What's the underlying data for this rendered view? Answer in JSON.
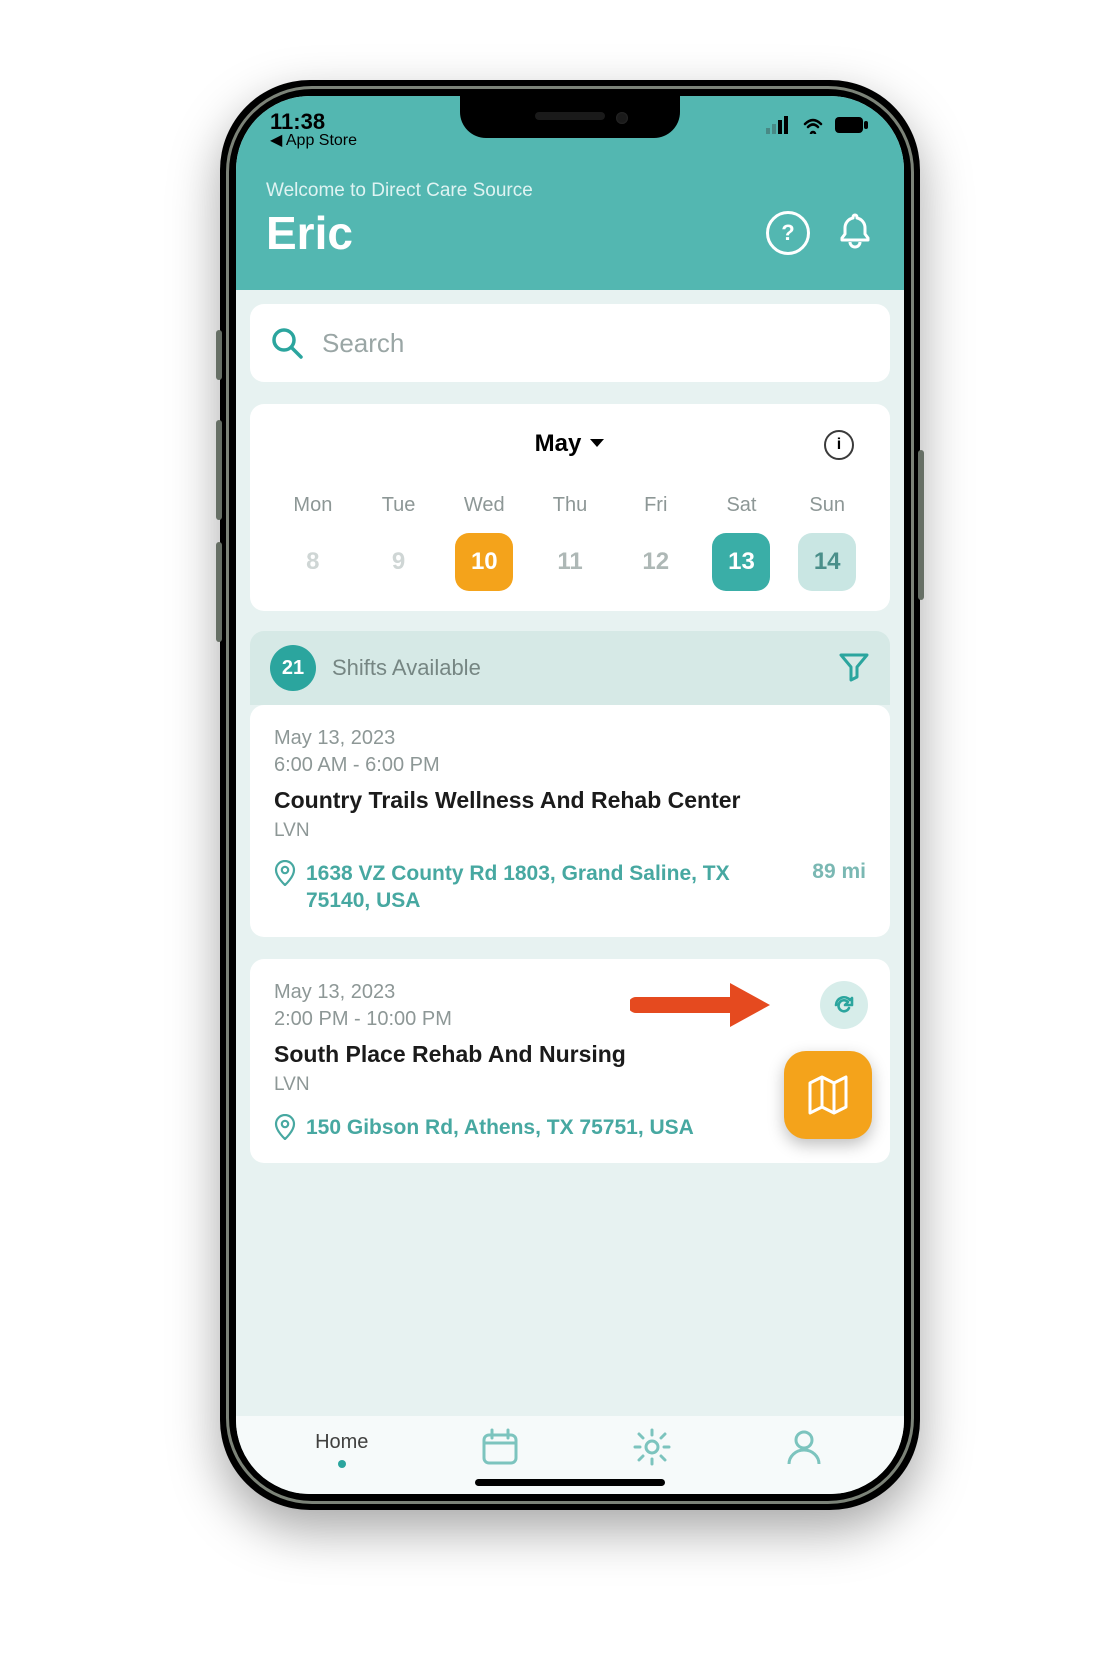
{
  "status": {
    "time": "11:38",
    "back": "◀ App Store"
  },
  "header": {
    "welcome": "Welcome to Direct Care Source",
    "name": "Eric"
  },
  "search": {
    "placeholder": "Search"
  },
  "calendar": {
    "month": "May",
    "days": [
      {
        "label": "Mon",
        "num": "8",
        "style": "dim"
      },
      {
        "label": "Tue",
        "num": "9",
        "style": "dim"
      },
      {
        "label": "Wed",
        "num": "10",
        "style": "orange"
      },
      {
        "label": "Thu",
        "num": "11",
        "style": "plain"
      },
      {
        "label": "Fri",
        "num": "12",
        "style": "plain"
      },
      {
        "label": "Sat",
        "num": "13",
        "style": "teal"
      },
      {
        "label": "Sun",
        "num": "14",
        "style": "lightteal"
      }
    ]
  },
  "shifts": {
    "count": "21",
    "label": "Shifts Available",
    "items": [
      {
        "date": "May 13, 2023",
        "time": "6:00 AM - 6:00 PM",
        "title": "Country Trails Wellness And Rehab Center",
        "role": "LVN",
        "address": "1638 VZ County Rd 1803, Grand Saline, TX 75140, USA",
        "distance": "89 mi"
      },
      {
        "date": "May 13, 2023",
        "time": "2:00 PM - 10:00 PM",
        "title": "South Place Rehab And Nursing",
        "role": "LVN",
        "address": "150 Gibson Rd, Athens, TX 75751, USA",
        "distance": ""
      }
    ]
  },
  "nav": {
    "home": "Home"
  },
  "colors": {
    "teal": "#53b7b1",
    "accent": "#f4a31b",
    "arrow": "#e54a1f"
  }
}
